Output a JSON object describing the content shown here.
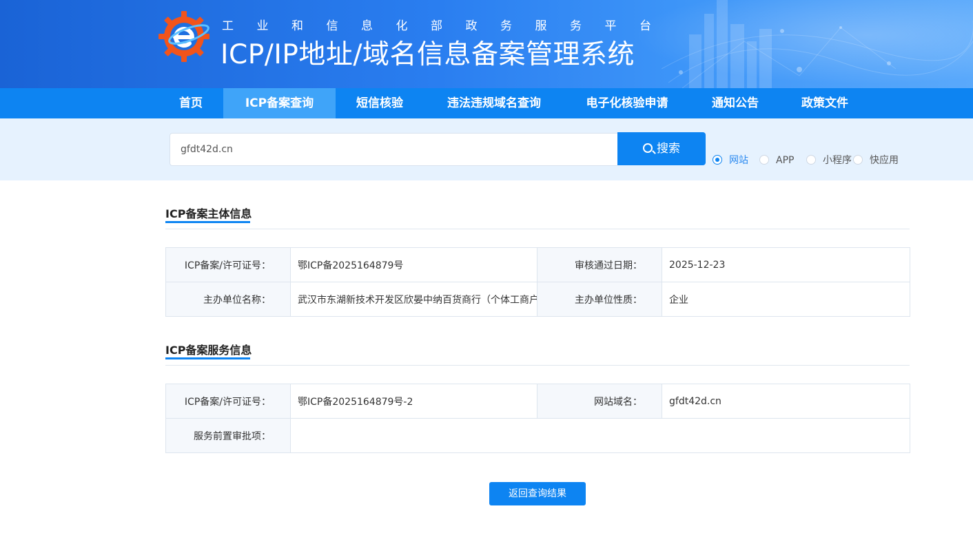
{
  "header": {
    "subtitle": "工业和信息化部政务服务平台",
    "title": "ICP/IP地址/域名信息备案管理系统"
  },
  "nav": {
    "items": [
      {
        "label": "首页",
        "active": false
      },
      {
        "label": "ICP备案查询",
        "active": true
      },
      {
        "label": "短信核验",
        "active": false
      },
      {
        "label": "违法违规域名查询",
        "active": false
      },
      {
        "label": "电子化核验申请",
        "active": false
      },
      {
        "label": "通知公告",
        "active": false
      },
      {
        "label": "政策文件",
        "active": false
      }
    ]
  },
  "search": {
    "value": "gfdt42d.cn",
    "button_label": "搜索",
    "types": [
      {
        "label": "网站",
        "checked": true
      },
      {
        "label": "APP",
        "checked": false
      },
      {
        "label": "小程序",
        "checked": false
      },
      {
        "label": "快应用",
        "checked": false
      }
    ]
  },
  "subject_info": {
    "title": "ICP备案主体信息",
    "rows": [
      {
        "label1": "ICP备案/许可证号：",
        "value1": "鄂ICP备2025164879号",
        "label2": "审核通过日期：",
        "value2": "2025-12-23"
      },
      {
        "label1": "主办单位名称：",
        "value1": "武汉市东湖新技术开发区欣晏中纳百货商行（个体工商户",
        "label2": "主办单位性质：",
        "value2": "企业"
      }
    ]
  },
  "service_info": {
    "title": "ICP备案服务信息",
    "rows": [
      {
        "label1": "ICP备案/许可证号：",
        "value1": "鄂ICP备2025164879号-2",
        "label2": "网站域名：",
        "value2": "gfdt42d.cn"
      },
      {
        "label1": "服务前置审批项：",
        "value1": ""
      }
    ]
  },
  "back_button_label": "返回查询结果",
  "colors": {
    "primary": "#0d84f2",
    "nav_active": "#3fa4f9",
    "search_band": "#e6f2fe",
    "logo_orange": "#f2541b"
  }
}
